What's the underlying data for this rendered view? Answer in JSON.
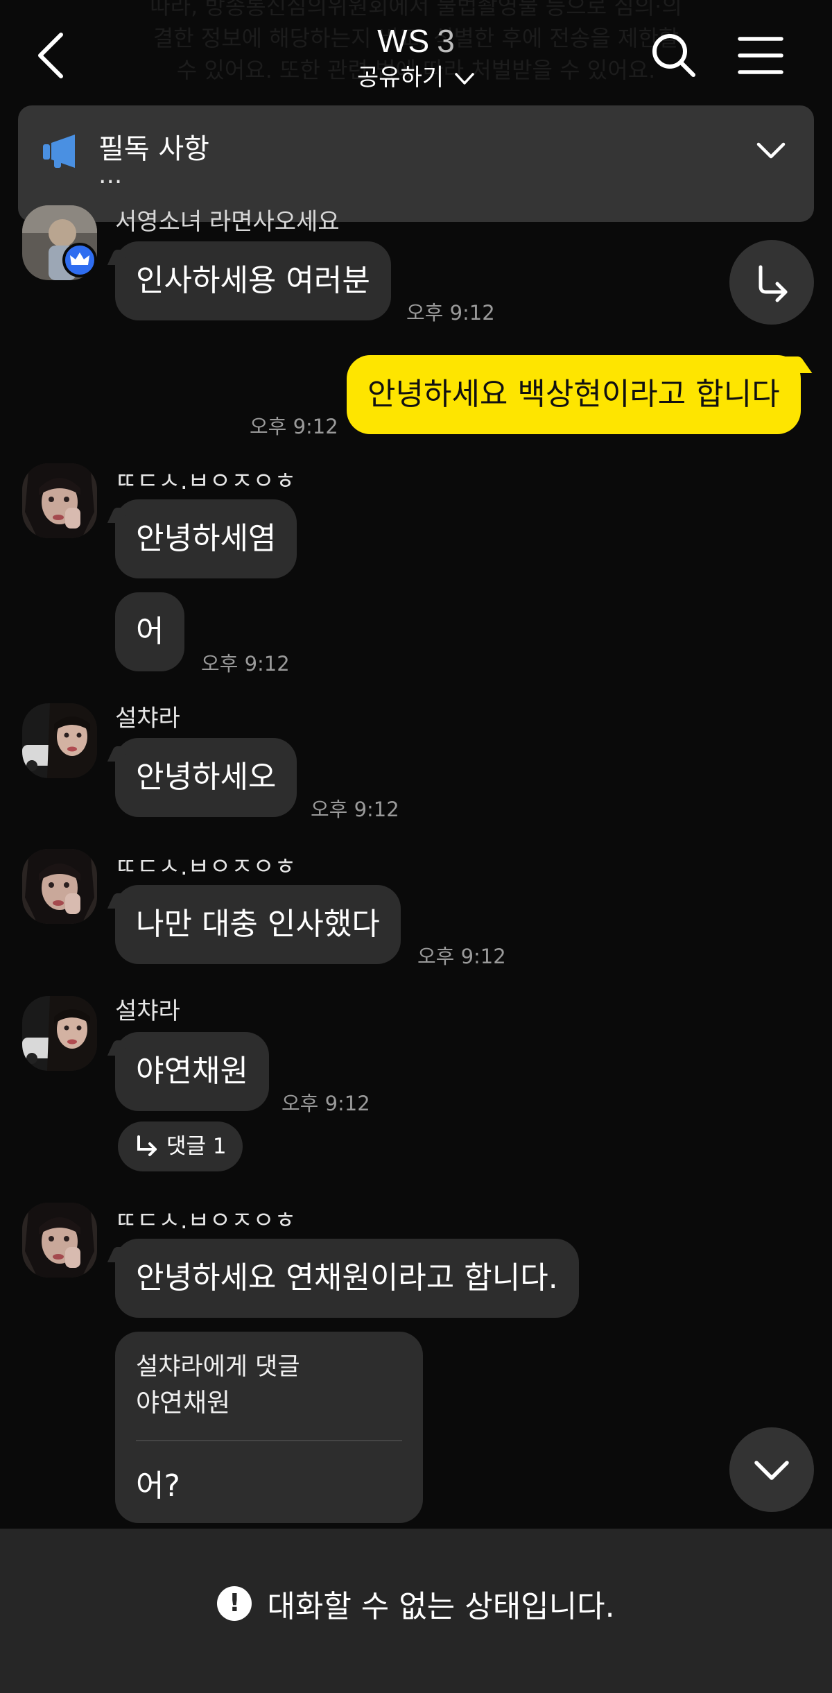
{
  "header": {
    "bg_notice_line1": "따라, 방송통신심의위원회에서 불법촬영물 등으로 심의·의",
    "bg_notice_line2": "결한 정보에 해당하는지 비교, 식별한 후에 전송을 제한할",
    "bg_notice_line3": "수 있어요. 또한 관련 법에 따라 처벌받을 수 있어요.",
    "title": "WS",
    "member_count": "3",
    "share_label": "공유하기",
    "back_icon": "chevron-left-icon",
    "search_icon": "search-icon",
    "menu_icon": "hamburger-menu-icon"
  },
  "notice": {
    "title": "필독 사항",
    "body": "...",
    "icon": "megaphone-icon",
    "accent": "#4a90e2"
  },
  "messages": [
    {
      "sender": "서영소녀 라면사오세요",
      "text": "인사하세용 여러분",
      "time": "오후 9:12",
      "badge": "crown-icon"
    },
    {
      "sender": "",
      "text": "안녕하세요 백상현이라고 합니다",
      "time": "오후 9:12",
      "mine": true
    },
    {
      "sender": "ㄸㄷㅅ.ㅂㅇㅈㅇㅎ",
      "text": "안녕하세염",
      "time": ""
    },
    {
      "sender": "",
      "text": "어",
      "time": "오후 9:12"
    },
    {
      "sender": "설챠라",
      "text": "안녕하세오",
      "time": "오후 9:12"
    },
    {
      "sender": "ㄸㄷㅅ.ㅂㅇㅈㅇㅎ",
      "text": "나만 대충 인사했다",
      "time": "오후 9:12"
    },
    {
      "sender": "설챠라",
      "text": "야연채원",
      "time": "오후 9:12"
    },
    {
      "sender": "ㄸㄷㅅ.ㅂㅇㅈㅇㅎ",
      "text": "안녕하세요 연채원이라고 합니다.",
      "time": ""
    }
  ],
  "reply_badge": {
    "label": "댓글 1",
    "icon": "reply-arrow-icon"
  },
  "quote": {
    "to": "설챠라에게 댓글",
    "quoted_text": "야연채원",
    "reply": "어?"
  },
  "buttons": {
    "share_icon": "share-arrow-icon",
    "scroll_down_icon": "chevron-down-icon"
  },
  "footer": {
    "status": "대화할 수 없는 상태입니다.",
    "icon": "exclamation-icon"
  },
  "colors": {
    "background": "#0a0a0a",
    "bubble": "#2d2d2d",
    "my_bubble": "#fee500",
    "footer": "#262626"
  }
}
